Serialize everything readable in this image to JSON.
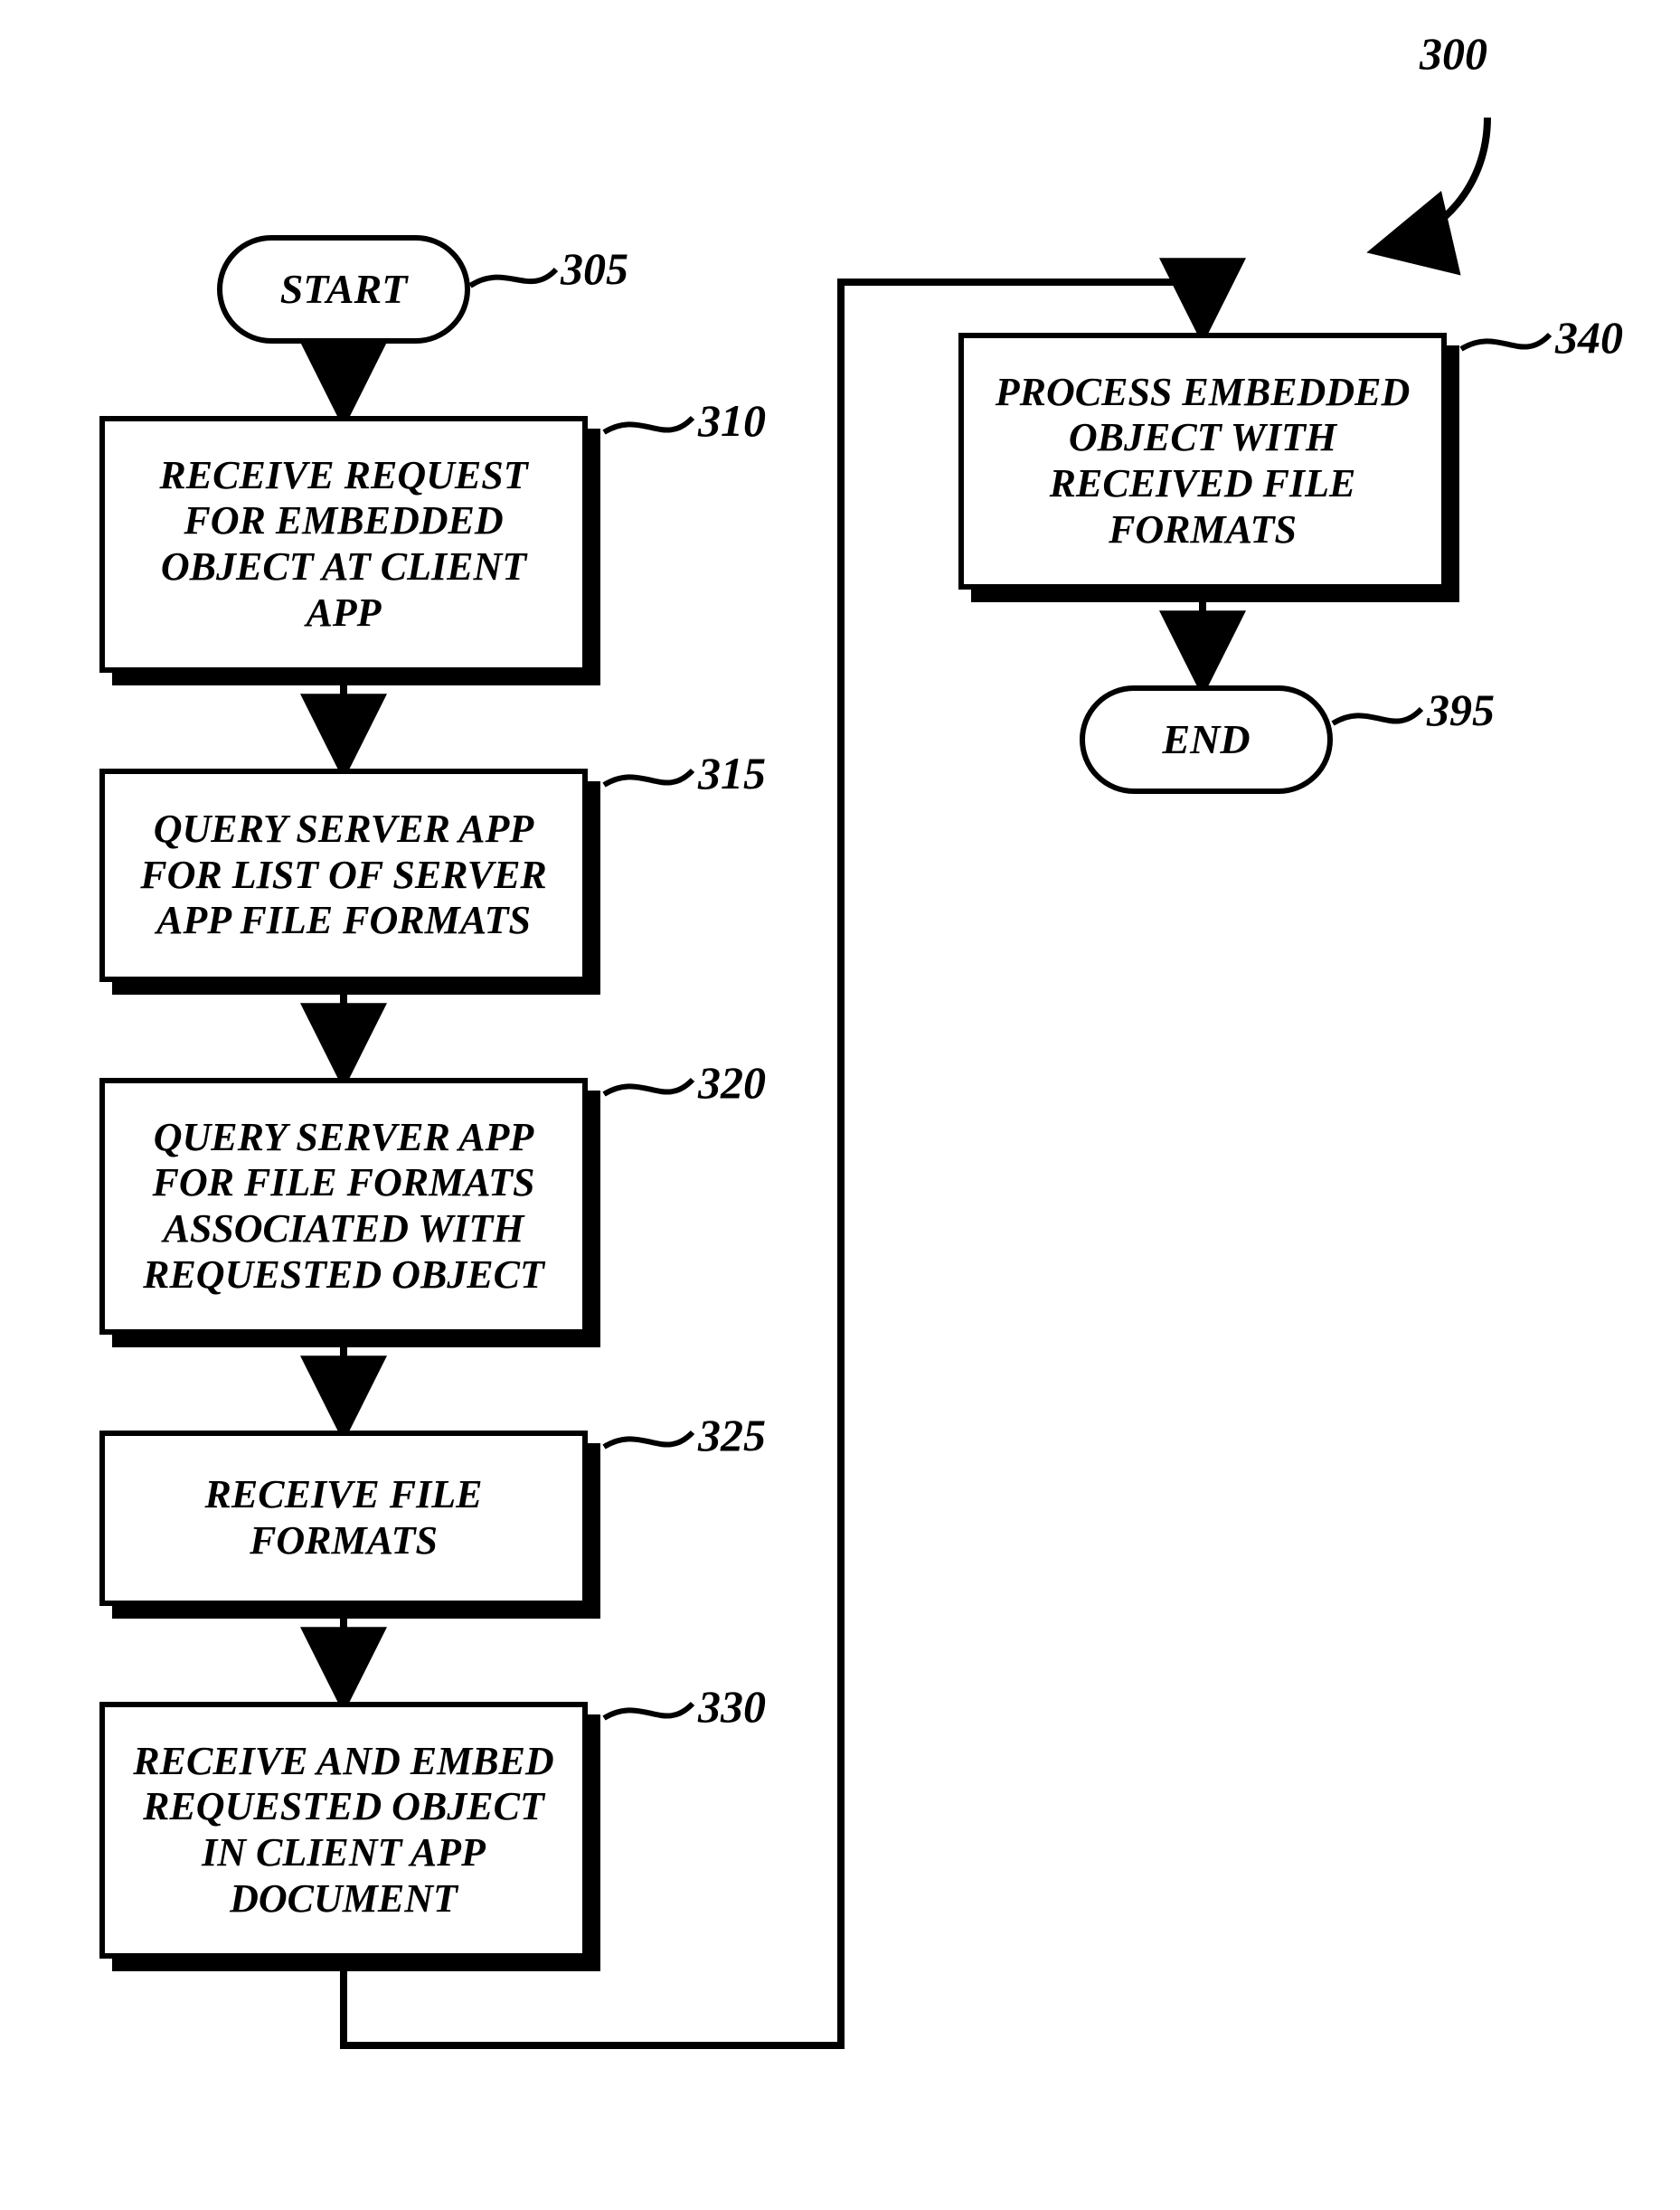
{
  "diagram_label": "300",
  "nodes": {
    "start": {
      "text": "START",
      "label": "305"
    },
    "s310": {
      "text": "RECEIVE REQUEST FOR EMBEDDED OBJECT AT CLIENT APP",
      "label": "310"
    },
    "s315": {
      "text": "QUERY SERVER APP FOR LIST OF SERVER APP FILE FORMATS",
      "label": "315"
    },
    "s320": {
      "text": "QUERY SERVER APP FOR FILE FORMATS ASSOCIATED WITH REQUESTED OBJECT",
      "label": "320"
    },
    "s325": {
      "text": "RECEIVE FILE FORMATS",
      "label": "325"
    },
    "s330": {
      "text": "RECEIVE AND EMBED REQUESTED OBJECT IN CLIENT APP DOCUMENT",
      "label": "330"
    },
    "s340": {
      "text": "PROCESS EMBEDDED OBJECT WITH RECEIVED FILE FORMATS",
      "label": "340"
    },
    "end": {
      "text": "END",
      "label": "395"
    }
  },
  "chart_data": {
    "type": "flowchart",
    "title": "",
    "diagram_ref": "300",
    "nodes": [
      {
        "id": "start",
        "kind": "terminator",
        "text": "START",
        "ref": "305"
      },
      {
        "id": "s310",
        "kind": "process",
        "text": "RECEIVE REQUEST FOR EMBEDDED OBJECT AT CLIENT APP",
        "ref": "310"
      },
      {
        "id": "s315",
        "kind": "process",
        "text": "QUERY SERVER APP FOR LIST OF SERVER APP FILE FORMATS",
        "ref": "315"
      },
      {
        "id": "s320",
        "kind": "process",
        "text": "QUERY SERVER APP FOR FILE FORMATS ASSOCIATED WITH REQUESTED OBJECT",
        "ref": "320"
      },
      {
        "id": "s325",
        "kind": "process",
        "text": "RECEIVE FILE FORMATS",
        "ref": "325"
      },
      {
        "id": "s330",
        "kind": "process",
        "text": "RECEIVE AND EMBED REQUESTED OBJECT IN CLIENT APP DOCUMENT",
        "ref": "330"
      },
      {
        "id": "s340",
        "kind": "process",
        "text": "PROCESS EMBEDDED OBJECT WITH RECEIVED FILE FORMATS",
        "ref": "340"
      },
      {
        "id": "end",
        "kind": "terminator",
        "text": "END",
        "ref": "395"
      }
    ],
    "edges": [
      {
        "from": "start",
        "to": "s310"
      },
      {
        "from": "s310",
        "to": "s315"
      },
      {
        "from": "s315",
        "to": "s320"
      },
      {
        "from": "s320",
        "to": "s325"
      },
      {
        "from": "s325",
        "to": "s330"
      },
      {
        "from": "s330",
        "to": "s340"
      },
      {
        "from": "s340",
        "to": "end"
      }
    ]
  }
}
